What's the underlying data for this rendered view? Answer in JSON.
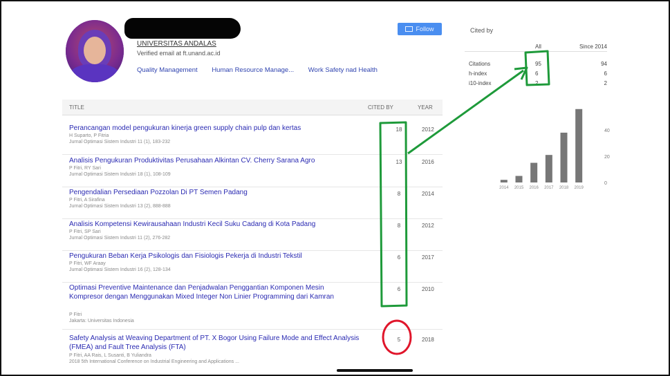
{
  "profile": {
    "affiliation": "UNIVERSITAS ANDALAS",
    "verified": "Verified email at ft.unand.ac.id",
    "interests": [
      "Quality Management",
      "Human Resource Manage...",
      "Work Safety nad Health"
    ]
  },
  "follow_label": "Follow",
  "table": {
    "headers": {
      "title": "TITLE",
      "cited_by": "CITED BY",
      "year": "YEAR"
    },
    "rows": [
      {
        "title": "Perancangan model pengukuran kinerja green supply chain pulp dan kertas",
        "authors": "H Suparto, P Fitria",
        "pub": "Jurnal Optimasi Sistem Industri 11 (1), 183-232",
        "cited": "18",
        "year": "2012"
      },
      {
        "title": "Analisis Pengukuran Produktivitas Perusahaan Alkintan CV. Cherry Sarana Agro",
        "authors": "P Fitri, RY Sari",
        "pub": "Jurnal Optimasi Sistem Industri 18 (1), 108-109",
        "cited": "13",
        "year": "2016"
      },
      {
        "title": "Pengendalian Persediaan Pozzolan Di PT Semen Padang",
        "authors": "P Fitri, A Sirafina",
        "pub": "Jurnal Optimasi Sistem Industri 13 (2), 888-888",
        "cited": "8",
        "year": "2014"
      },
      {
        "title": "Analisis Kompetensi Kewirausahaan Industri Kecil Suku Cadang di Kota Padang",
        "authors": "P Fitri, SP Sari",
        "pub": "Jurnal Optimasi Sistem Industri 11 (2), 276-282",
        "cited": "8",
        "year": "2012"
      },
      {
        "title": "Pengukuran Beban Kerja Psikologis dan Fisiologis Pekerja di Industri Tekstil",
        "authors": "P Fitri, WF Araay",
        "pub": "Jurnal Optimasi Sistem Industri 16 (2), 128-134",
        "cited": "6",
        "year": "2017"
      },
      {
        "title": "Optimasi Preventive Maintenance dan Penjadwalan Penggantian Komponen Mesin Kompresor dengan Menggunakan Mixed Integer Non Linier Programming dari Kamran",
        "authors": "P Fitri",
        "pub": "Jakarta: Universitas Indonesia",
        "cited": "6",
        "year": "2010"
      },
      {
        "title": "Safety Analysis at Weaving Department of PT. X Bogor Using Failure Mode and Effect Analysis (FMEA) and Fault Tree Analysis (FTA)",
        "authors": "P Fitri, AA Rais, L Susanti, B Yuliandra",
        "pub": "2018 5th International Conference on Industrial Engineering and Applications ...",
        "cited": "5",
        "year": "2018"
      }
    ]
  },
  "cited_by": {
    "title": "Cited by",
    "col_all": "All",
    "col_since": "Since 2014",
    "rows": [
      {
        "label": "Citations",
        "all": "95",
        "since": "94"
      },
      {
        "label": "h-index",
        "all": "6",
        "since": "6"
      },
      {
        "label": "i10-index",
        "all": "2",
        "since": "2"
      }
    ]
  },
  "chart_data": {
    "type": "bar",
    "categories": [
      "2014",
      "2015",
      "2016",
      "2017",
      "2018",
      "2019"
    ],
    "values": [
      2,
      5,
      15,
      21,
      38,
      56
    ],
    "yticks": [
      "0",
      "20",
      "40"
    ],
    "ylim": [
      0,
      58
    ],
    "color": "#777777"
  },
  "annotations": {
    "green": "#1e9a3a",
    "red": "#e0152a"
  }
}
